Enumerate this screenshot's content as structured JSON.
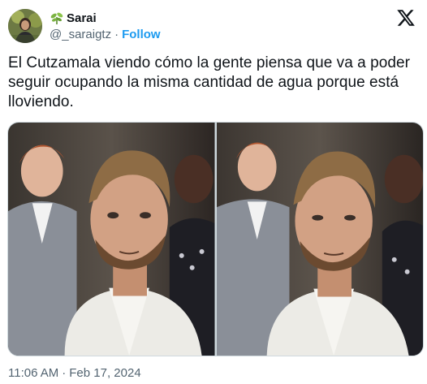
{
  "author": {
    "display_name": "Sarai",
    "handle": "@_saraigtz",
    "separator": "·",
    "follow_label": "Follow",
    "badge_icon": "plant-sprout-icon"
  },
  "brand": {
    "logo": "x-logo-icon"
  },
  "tweet": {
    "text": "El Cutzamala viendo cómo la gente piensa que va a poder seguir ocupando la misma cantidad de agua porque está lloviendo."
  },
  "media": {
    "photos": [
      {
        "name": "photo-left"
      },
      {
        "name": "photo-right"
      }
    ]
  },
  "footer": {
    "time": "11:06 AM",
    "separator": "·",
    "date": "Feb 17, 2024"
  },
  "colors": {
    "text": "#0f1419",
    "secondary": "#536471",
    "accent": "#1d9bf0",
    "border": "#cfd9de"
  }
}
